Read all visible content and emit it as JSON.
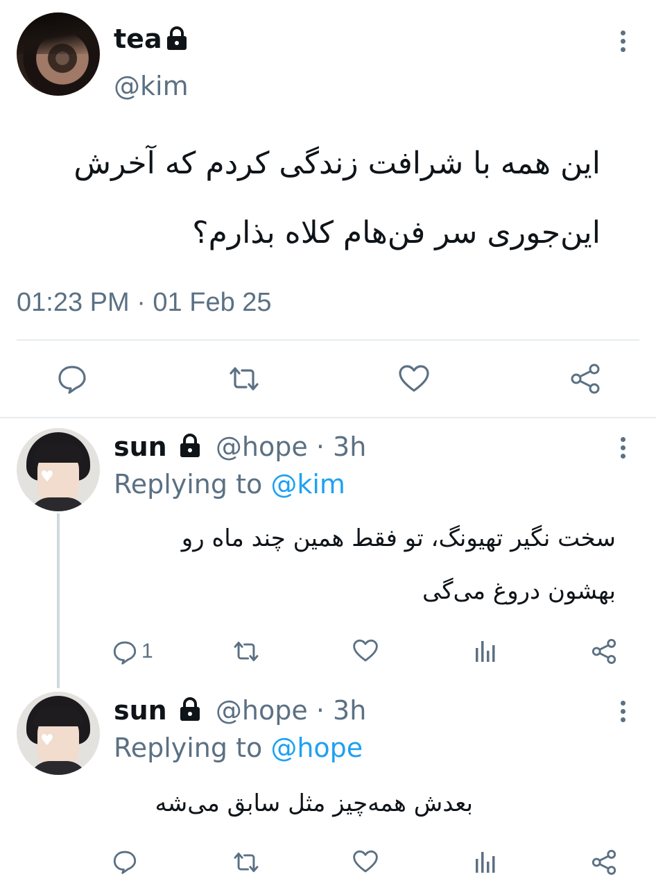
{
  "main_tweet": {
    "display_name": "tea",
    "handle": "@kim",
    "text_line1": "این همه با شرافت زندگی کردم که آخرش",
    "text_line2": "این‌جوری سر فن‌هام کلاه بذارم؟",
    "timestamp": "01:23 PM · 01 Feb 25",
    "actions": [
      "comment-icon",
      "retweet-icon",
      "heart-icon",
      "share-icon"
    ]
  },
  "replies": [
    {
      "display_name": "sun",
      "handle": "@hope",
      "time_meta": "· 3h",
      "replying_label": "Replying to",
      "replying_to": "@kim",
      "text_line1": "سخت نگیر تهیونگ، تو فقط همین چند ماه رو",
      "text_line2": "بهشون دروغ می‌گی",
      "reply_count": "1"
    },
    {
      "display_name": "sun",
      "handle": "@hope",
      "time_meta": "· 3h",
      "replying_label": "Replying to",
      "replying_to": "@hope",
      "text_line1": "بعدش همه‌چیز مثل سابق می‌شه",
      "reply_count": ""
    }
  ],
  "colors": {
    "text": "#0f1419",
    "muted": "#5b7083",
    "link": "#1da1f2",
    "divider": "#e6ecf0"
  }
}
